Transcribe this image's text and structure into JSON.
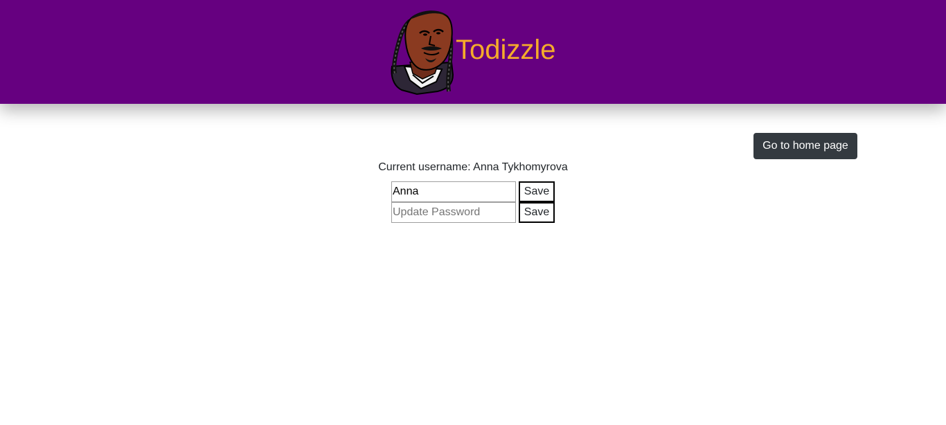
{
  "header": {
    "app_title": "Todizzle",
    "logo_icon": "rapper-avatar-icon",
    "background_color": "#660080",
    "title_color": "#f5ab2b"
  },
  "nav": {
    "home_button_label": "Go to home page"
  },
  "profile": {
    "current_username_label": "Current username: Anna Tykhomyrova",
    "username_input_value": "Anna",
    "username_save_label": "Save",
    "password_placeholder": "Update Password",
    "password_save_label": "Save"
  }
}
